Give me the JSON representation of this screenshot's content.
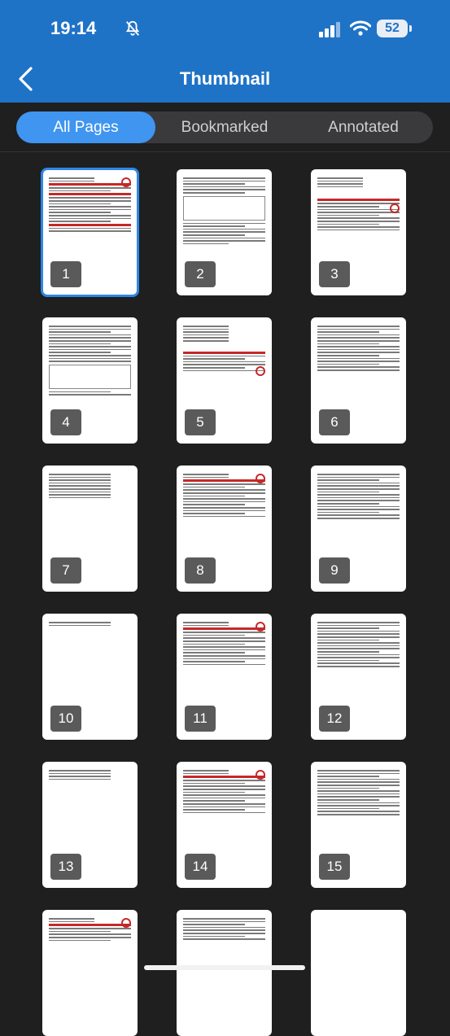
{
  "status": {
    "time": "19:14",
    "battery": "52"
  },
  "header": {
    "title": "Thumbnail"
  },
  "tabs": [
    {
      "label": "All Pages"
    },
    {
      "label": "Bookmarked"
    },
    {
      "label": "Annotated"
    }
  ],
  "pages": [
    {
      "number": "1"
    },
    {
      "number": "2"
    },
    {
      "number": "3"
    },
    {
      "number": "4"
    },
    {
      "number": "5"
    },
    {
      "number": "6"
    },
    {
      "number": "7"
    },
    {
      "number": "8"
    },
    {
      "number": "9"
    },
    {
      "number": "10"
    },
    {
      "number": "11"
    },
    {
      "number": "12"
    },
    {
      "number": "13"
    },
    {
      "number": "14"
    },
    {
      "number": "15"
    },
    {
      "number": ""
    },
    {
      "number": ""
    },
    {
      "number": ""
    }
  ]
}
